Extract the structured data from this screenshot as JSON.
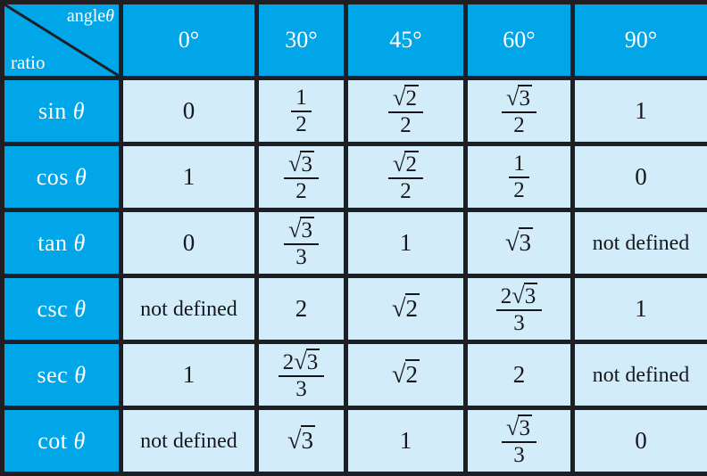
{
  "table": {
    "corner": {
      "angle_label": "angle",
      "angle_symbol": "θ",
      "ratio_label": "ratio",
      "diagonal": "diagonal-divider"
    },
    "colors": {
      "header_blue": "#00a6e8",
      "cell_light_blue": "#d3ecfa",
      "border_dark": "#1f1f23",
      "header_text": "#ffffff",
      "cell_text": "#17171b"
    },
    "columns": [
      {
        "label": "0°"
      },
      {
        "label": "30°"
      },
      {
        "label": "45°"
      },
      {
        "label": "60°"
      },
      {
        "label": "90°"
      }
    ],
    "rows": [
      {
        "ratio": "sin",
        "symbol": "θ",
        "cells": [
          {
            "kind": "plain",
            "text": "0"
          },
          {
            "kind": "fraction",
            "num": "1",
            "den": "2"
          },
          {
            "kind": "fraction",
            "num_radical": "2",
            "den": "2"
          },
          {
            "kind": "fraction",
            "num_radical": "3",
            "den": "2"
          },
          {
            "kind": "plain",
            "text": "1"
          }
        ]
      },
      {
        "ratio": "cos",
        "symbol": "θ",
        "cells": [
          {
            "kind": "plain",
            "text": "1"
          },
          {
            "kind": "fraction",
            "num_radical": "3",
            "den": "2"
          },
          {
            "kind": "fraction",
            "num_radical": "2",
            "den": "2"
          },
          {
            "kind": "fraction",
            "num": "1",
            "den": "2"
          },
          {
            "kind": "plain",
            "text": "0"
          }
        ]
      },
      {
        "ratio": "tan",
        "symbol": "θ",
        "cells": [
          {
            "kind": "plain",
            "text": "0"
          },
          {
            "kind": "fraction",
            "num_radical": "3",
            "den": "3"
          },
          {
            "kind": "plain",
            "text": "1"
          },
          {
            "kind": "radical",
            "radicand": "3"
          },
          {
            "kind": "words",
            "text": "not defined"
          }
        ]
      },
      {
        "ratio": "csc",
        "symbol": "θ",
        "cells": [
          {
            "kind": "words",
            "text": "not defined"
          },
          {
            "kind": "plain",
            "text": "2"
          },
          {
            "kind": "radical",
            "radicand": "2"
          },
          {
            "kind": "fraction",
            "num_coef": "2",
            "num_radical": "3",
            "den": "3"
          },
          {
            "kind": "plain",
            "text": "1"
          }
        ]
      },
      {
        "ratio": "sec",
        "symbol": "θ",
        "cells": [
          {
            "kind": "plain",
            "text": "1"
          },
          {
            "kind": "fraction",
            "num_coef": "2",
            "num_radical": "3",
            "den": "3"
          },
          {
            "kind": "radical",
            "radicand": "2"
          },
          {
            "kind": "plain",
            "text": "2"
          },
          {
            "kind": "words",
            "text": "not defined"
          }
        ]
      },
      {
        "ratio": "cot",
        "symbol": "θ",
        "cells": [
          {
            "kind": "words",
            "text": "not defined"
          },
          {
            "kind": "radical",
            "radicand": "3"
          },
          {
            "kind": "plain",
            "text": "1"
          },
          {
            "kind": "fraction",
            "num_radical": "3",
            "den": "3"
          },
          {
            "kind": "plain",
            "text": "0"
          }
        ]
      }
    ]
  }
}
